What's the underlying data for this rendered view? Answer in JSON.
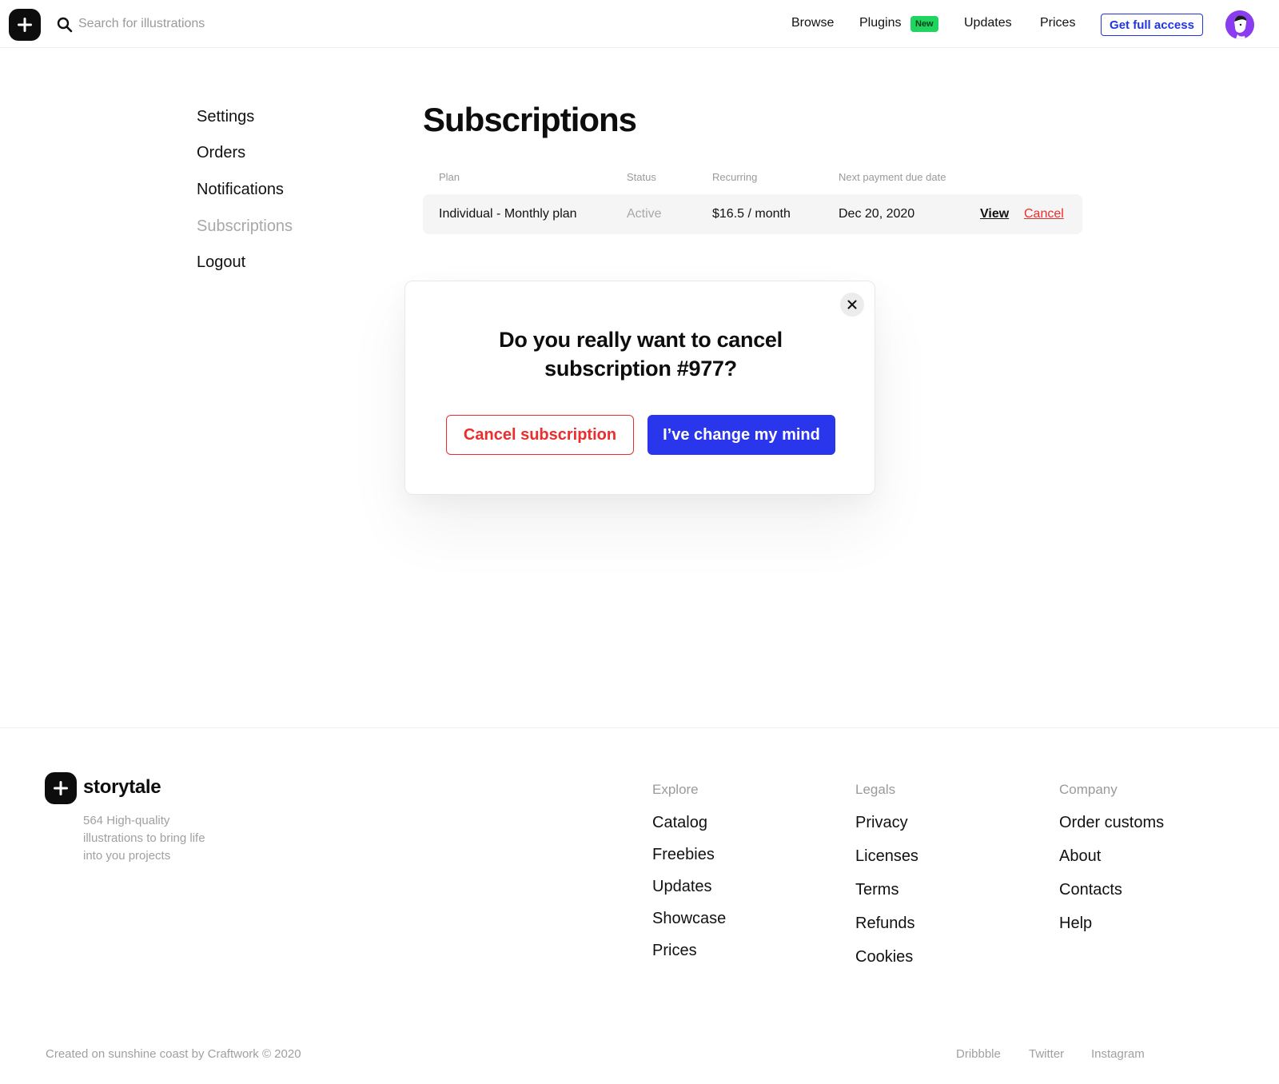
{
  "header": {
    "search_placeholder": "Search for illustrations",
    "nav": [
      "Browse",
      "Plugins",
      "Updates",
      "Prices"
    ],
    "new_badge": "New",
    "cta_label": "Get full access",
    "accent_color": "#2234e6",
    "badge_color": "#1fd55f"
  },
  "sidebar": {
    "items": [
      "Settings",
      "Orders",
      "Notifications",
      "Subscriptions",
      "Logout"
    ],
    "active": "Subscriptions"
  },
  "main": {
    "title": "Subscriptions",
    "table": {
      "headers": [
        "Plan",
        "Status",
        "Recurring",
        "Next payment due date"
      ],
      "rows": [
        {
          "plan": "Individual - Monthly plan",
          "status": "Active",
          "recurring": "$16.5 / month",
          "next_payment": "Dec 20, 2020",
          "view_label": "View",
          "cancel_label": "Cancel"
        }
      ]
    }
  },
  "modal": {
    "title_line1": "Do you really want to cancel",
    "title_line2": "subscription #977?",
    "confirm_label": "Cancel subscription",
    "dismiss_label": "I’ve change my mind",
    "danger_color": "#ec2d2d",
    "primary_color": "#2a36eb"
  },
  "footer": {
    "brand": "storytale",
    "tagline": "564 High-quality illustrations to bring life into you projects",
    "columns": [
      {
        "heading": "Explore",
        "links": [
          "Catalog",
          "Freebies",
          "Updates",
          "Showcase",
          "Prices"
        ]
      },
      {
        "heading": "Legals",
        "links": [
          "Privacy",
          "Licenses",
          "Terms",
          "Refunds",
          "Cookies"
        ]
      },
      {
        "heading": "Company",
        "links": [
          "Order customs",
          "About",
          "Contacts",
          "Help"
        ]
      }
    ],
    "copyright": "Created on sunshine coast by Craftwork © 2020",
    "social": [
      "Dribbble",
      "Twitter",
      "Instagram"
    ]
  }
}
